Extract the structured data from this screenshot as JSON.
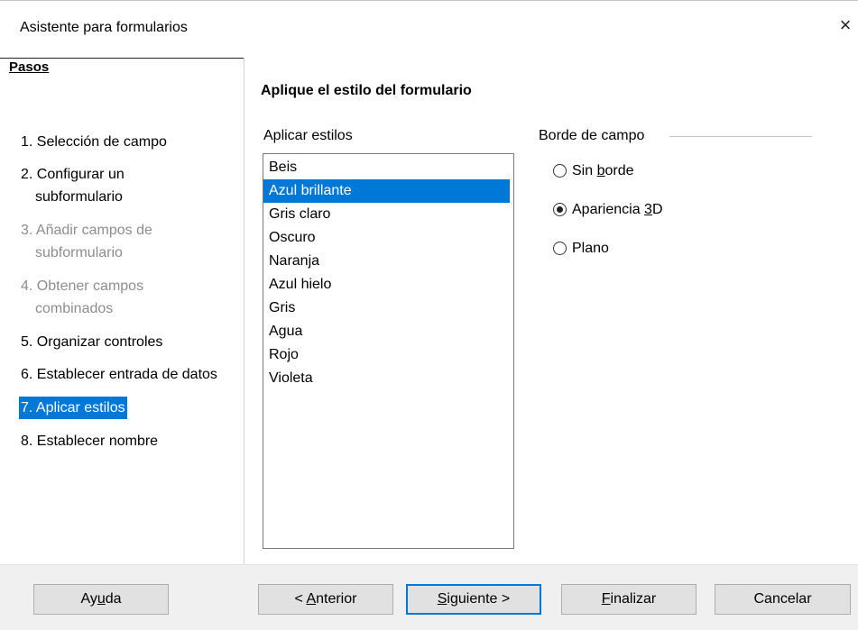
{
  "window": {
    "title": "Asistente para formularios",
    "close_glyph": "×"
  },
  "steps": {
    "header": "Pasos",
    "items": [
      {
        "label": "1. Selección de campo",
        "state": "normal"
      },
      {
        "label": "2. Configurar un subformulario",
        "line1": "2. Configurar un",
        "line2": "subformulario",
        "state": "normal"
      },
      {
        "label": "3. Añadir campos de subformulario",
        "line1": "3. Añadir campos de",
        "line2": "subformulario",
        "state": "disabled"
      },
      {
        "label": "4. Obtener campos combinados",
        "line1": "4. Obtener campos",
        "line2": "combinados",
        "state": "disabled"
      },
      {
        "label": "5. Organizar controles",
        "state": "normal"
      },
      {
        "label": "6. Establecer entrada de datos",
        "state": "normal"
      },
      {
        "label": "7. Aplicar estilos",
        "state": "selected"
      },
      {
        "label": "8. Establecer nombre",
        "state": "normal"
      }
    ]
  },
  "page": {
    "heading": "Aplique el estilo del formulario",
    "styles_label": "Aplicar estilos",
    "styles": [
      "Beis",
      "Azul brillante",
      "Gris claro",
      "Oscuro",
      "Naranja",
      "Azul hielo",
      "Gris",
      "Agua",
      "Rojo",
      "Violeta"
    ],
    "selected_style": "Azul brillante"
  },
  "border": {
    "label": "Borde de campo",
    "options": [
      {
        "label": "Sin borde",
        "checked": false
      },
      {
        "label": "Apariencia 3D",
        "checked": true
      },
      {
        "label": "Plano",
        "checked": false
      }
    ]
  },
  "buttons": {
    "help": "Ayuda",
    "back": "< Anterior",
    "next": "Siguiente >",
    "finish": "Finalizar",
    "cancel": "Cancelar"
  },
  "colors": {
    "selection": "#0078d7",
    "disabled_text": "#8d8d8d",
    "footer_bg": "#f0f0f0"
  }
}
